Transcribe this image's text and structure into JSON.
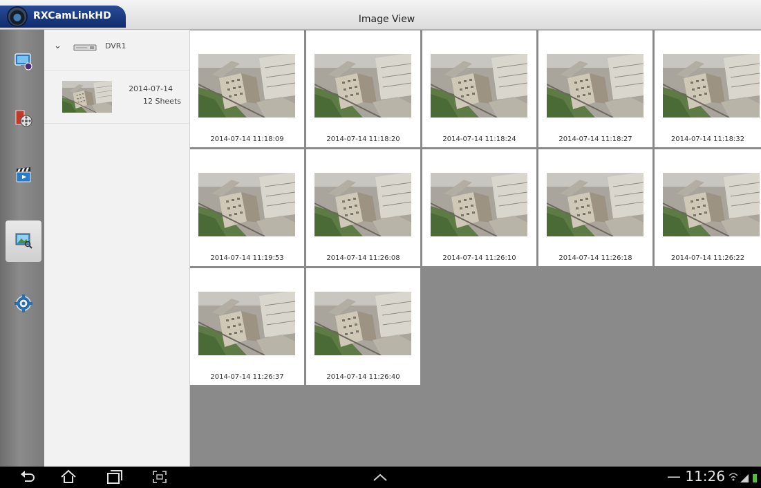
{
  "app": {
    "name": "RXCamLinkHD",
    "view_title": "Image View"
  },
  "rail": {
    "items": [
      {
        "name": "live-view",
        "icon": "monitor-camera-icon"
      },
      {
        "name": "playback",
        "icon": "film-reel-icon"
      },
      {
        "name": "video-files",
        "icon": "clapperboard-icon"
      },
      {
        "name": "image-view",
        "icon": "image-search-icon",
        "active": true
      },
      {
        "name": "settings",
        "icon": "gear-icon"
      }
    ]
  },
  "tree": {
    "device": "DVR1",
    "dates": [
      {
        "date": "2014-07-14",
        "count": "12 Sheets"
      }
    ]
  },
  "images": [
    "2014-07-14 11:18:09",
    "2014-07-14 11:18:20",
    "2014-07-14 11:18:24",
    "2014-07-14 11:18:27",
    "2014-07-14 11:18:32",
    "2014-07-14 11:19:53",
    "2014-07-14 11:26:08",
    "2014-07-14 11:26:10",
    "2014-07-14 11:26:18",
    "2014-07-14 11:26:22",
    "2014-07-14 11:26:37",
    "2014-07-14 11:26:40"
  ],
  "statusbar": {
    "time": "11:26"
  },
  "colors": {
    "app_tab": "#1c3a80",
    "rail": "#7b7b7b",
    "panel": "#f2f2f2",
    "grid_bg": "#8a8a8a",
    "navbar": "#000000"
  }
}
